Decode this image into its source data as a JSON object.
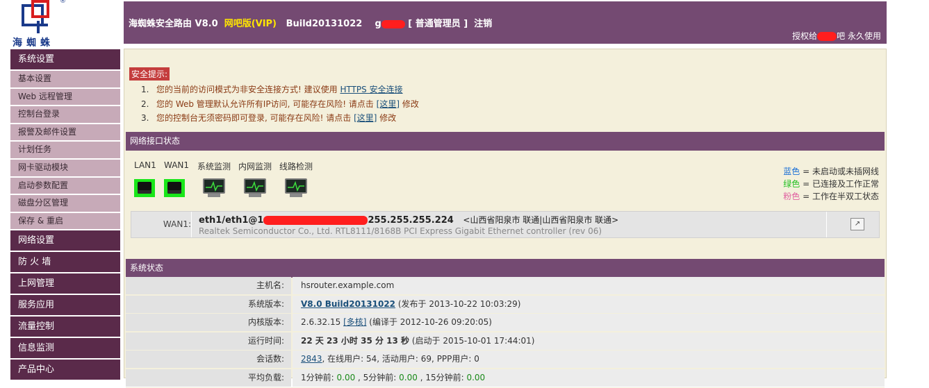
{
  "logo": {
    "text": "海蜘蛛",
    "mark": "®"
  },
  "sidebar": {
    "sections": [
      {
        "label": "系统设置",
        "items": [
          "基本设置",
          "Web 远程管理",
          "控制台登录",
          "报警及邮件设置",
          "计划任务",
          "网卡驱动模块",
          "启动参数配置",
          "磁盘分区管理",
          "保存 & 重启"
        ]
      },
      {
        "label": "网络设置",
        "items": []
      },
      {
        "label": "防 火 墙",
        "items": []
      },
      {
        "label": "上网管理",
        "items": []
      },
      {
        "label": "服务应用",
        "items": []
      },
      {
        "label": "流量控制",
        "items": []
      },
      {
        "label": "信息监测",
        "items": []
      },
      {
        "label": "产品中心",
        "items": []
      }
    ]
  },
  "header": {
    "product": "海蜘蛛安全路由 V8.0",
    "edition": "网吧版(VIP)",
    "build": "Build20131022",
    "user_prefix": "g",
    "role": "[ 普通管理员 ]",
    "logout": "注销",
    "license_prefix": "授权给",
    "license_suffix": "吧 永久使用"
  },
  "security": {
    "title": "安全提示:",
    "items": [
      {
        "num": "1.",
        "text": "您的当前的访问模式为非安全连接方式!   建议使用 ",
        "link": "HTTPS 安全连接",
        "after": ""
      },
      {
        "num": "2.",
        "text": "您的 Web 管理默认允许所有IP访问, 可能存在风险!   请点击 ",
        "link": "[这里]",
        "after": " 修改"
      },
      {
        "num": "3.",
        "text": "您的控制台无须密码即可登录, 可能存在风险!   请点击 ",
        "link": "[这里]",
        "after": " 修改"
      }
    ]
  },
  "network": {
    "title": "网络接口状态",
    "interfaces": [
      "LAN1",
      "WAN1",
      "系统监测",
      "内网监测",
      "线路检测"
    ],
    "legend": [
      {
        "color": "#1a6fd6",
        "word": "蓝色",
        "desc": " = 未启动或未插网线"
      },
      {
        "color": "#22c022",
        "word": "绿色",
        "desc": " = 已连接及工作正常"
      },
      {
        "color": "#e060a0",
        "word": "粉色",
        "desc": " = 工作在半双工状态"
      }
    ],
    "wan": {
      "label": "WAN1:",
      "addr_prefix": "eth1/eth1@1",
      "mask": "255.255.255.224",
      "location": "<山西省阳泉市 联通|山西省阳泉市 联通>",
      "nic": "Realtek Semiconductor Co., Ltd. RTL8111/8168B PCI Express Gigabit Ethernet controller (rev 06)"
    }
  },
  "system": {
    "title": "系统状态",
    "rows": [
      {
        "k": "主机名:",
        "v": "hsrouter.example.com"
      },
      {
        "k": "系统版本:",
        "link": "V8.0 Build20131022",
        "v": " (发布于 2013-10-22 10:03:29)"
      },
      {
        "k": "内核版本:",
        "v": "2.6.32.15 ",
        "link": "[多核]",
        "after": " (编译于 2012-10-26 09:20:05)"
      },
      {
        "k": "运行时间:",
        "bold": "22 天 23 小时 35 分 13 秒",
        "v": " (启动于 2015-10-01 17:44:01)"
      },
      {
        "k": "会话数:",
        "link": "2843",
        "v": ",   在线用户: 54,   活动用户: 69,   PPP用户: 0"
      },
      {
        "k": "平均负载:",
        "v": "1分钟前: ",
        "g1": "0.00",
        "m1": " ,  5分钟前: ",
        "g2": "0.00",
        "m2": " ,  15分钟前: ",
        "g3": "0.00"
      }
    ]
  }
}
